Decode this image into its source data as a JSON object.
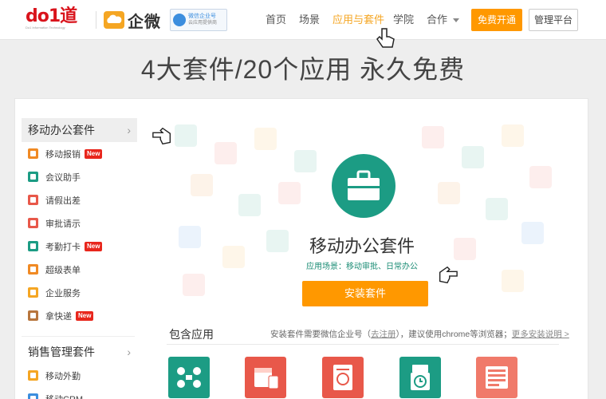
{
  "header": {
    "brand_do1": "do1道",
    "brand_do1_sub": "Do1 Information Technology",
    "brand_product": "企微",
    "wechat_badge_line1": "微信企业号",
    "wechat_badge_line2": "云应用提供商",
    "nav": [
      {
        "label": "首页",
        "active": false
      },
      {
        "label": "场景",
        "active": false
      },
      {
        "label": "应用与套件",
        "active": true
      },
      {
        "label": "学院",
        "active": false
      },
      {
        "label": "合作",
        "active": false,
        "dropdown": true
      }
    ],
    "btn_open": "免费开通",
    "btn_admin": "管理平台"
  },
  "hero": {
    "title": "4大套件/20个应用  永久免费"
  },
  "sidebar": {
    "suites": [
      {
        "label": "移动办公套件",
        "active": true,
        "items": [
          {
            "label": "移动报销",
            "new": true,
            "color": "#f08a24"
          },
          {
            "label": "会议助手",
            "new": false,
            "color": "#1c9c84"
          },
          {
            "label": "请假出差",
            "new": false,
            "color": "#e8584a"
          },
          {
            "label": "审批请示",
            "new": false,
            "color": "#e8584a"
          },
          {
            "label": "考勤打卡",
            "new": true,
            "color": "#1c9c84"
          },
          {
            "label": "超级表单",
            "new": false,
            "color": "#f08a24"
          },
          {
            "label": "企业服务",
            "new": false,
            "color": "#f5a623"
          },
          {
            "label": "拿快递",
            "new": true,
            "color": "#b8763e"
          }
        ]
      },
      {
        "label": "销售管理套件",
        "active": false,
        "items": [
          {
            "label": "移动外勤",
            "new": false,
            "color": "#f5a623"
          },
          {
            "label": "移动CRM",
            "new": false,
            "color": "#3c8ede"
          }
        ]
      }
    ],
    "new_badge": "New",
    "arrow": "›"
  },
  "main": {
    "suite_title": "移动办公套件",
    "scene": "应用场景：移动审批、日常办公",
    "install_button": "安装套件",
    "included_title": "包含应用",
    "note_prefix": "安装套件需要微信企业号（",
    "note_link1": "去注册",
    "note_mid": "），建议使用chrome等浏览器；",
    "note_link2": "更多安装说明 >"
  },
  "app_icons": [
    {
      "name": "meeting-icon",
      "color": "#1c9c84"
    },
    {
      "name": "calendar-icon",
      "color": "#e8584a"
    },
    {
      "name": "approval-icon",
      "color": "#e8584a"
    },
    {
      "name": "attendance-icon",
      "color": "#1c9c84"
    },
    {
      "name": "form-icon",
      "color": "#f07a6a"
    }
  ],
  "colors": {
    "accent": "#ff9800",
    "teal": "#1c9c84",
    "brand_red": "#d9141c"
  }
}
